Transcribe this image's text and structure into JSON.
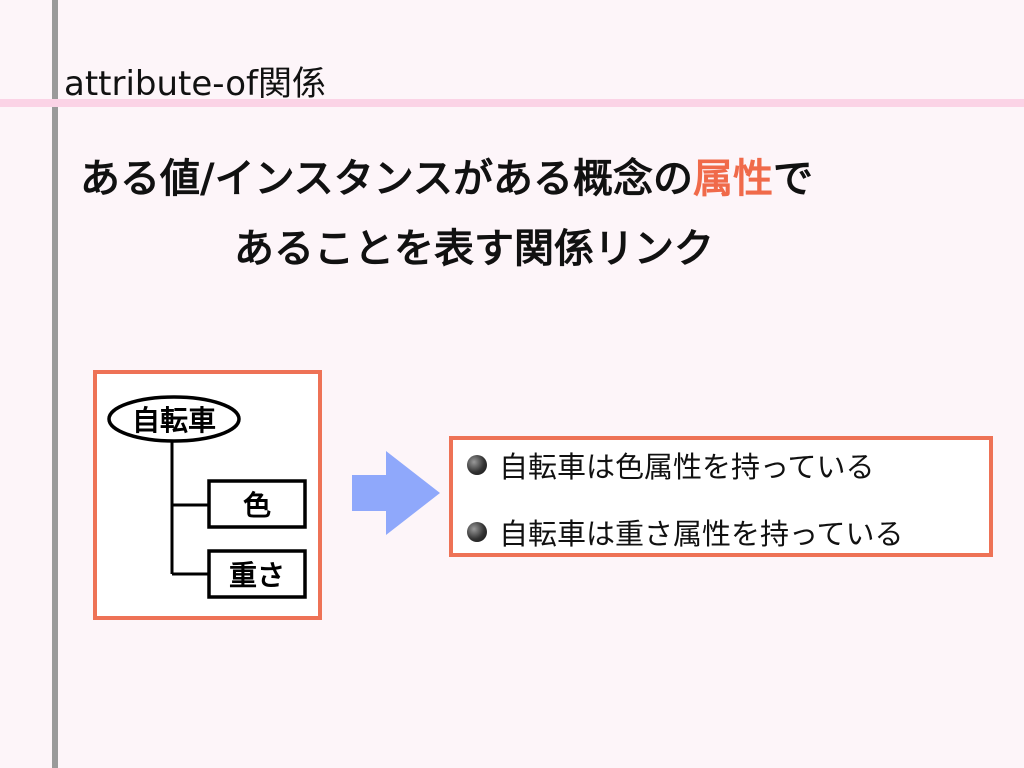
{
  "slide": {
    "title": "attribute-of関係",
    "headline": {
      "line1_before": "ある値/インスタンスがある概念の",
      "line1_accent": "属性",
      "line1_after": "で",
      "line2": "あることを表す関係リンク"
    }
  },
  "diagram": {
    "root": "自転車",
    "children": [
      "色",
      "重さ"
    ],
    "bullets": [
      "自転車は色属性を持っている",
      "自転車は重さ属性を持っている"
    ]
  },
  "colors": {
    "accent": "#ee7256",
    "arrow": "#8fa8fb",
    "guide_vertical": "#9a9a9a",
    "guide_horizontal": "#fbd3e6",
    "background": "#fdf5f9"
  }
}
